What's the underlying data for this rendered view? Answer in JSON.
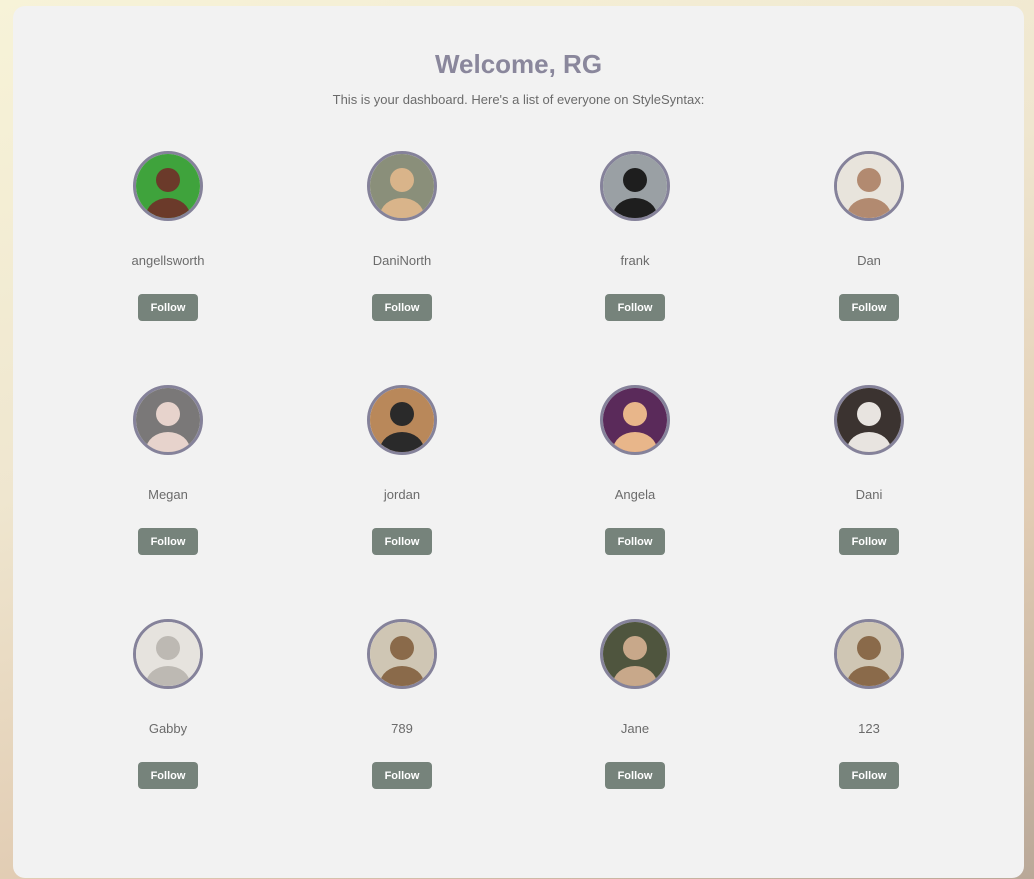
{
  "header": {
    "title": "Welcome, RG",
    "subtitle": "This is your dashboard. Here's a list of everyone on StyleSyntax:"
  },
  "users": [
    {
      "name": "angellsworth",
      "follow_label": "Follow",
      "avatar": "photo-avatar-icon",
      "bg": "#3fa33c",
      "fg": "#6b3a2a"
    },
    {
      "name": "DaniNorth",
      "follow_label": "Follow",
      "avatar": "photo-avatar-icon",
      "bg": "#8a8f7a",
      "fg": "#d9b48a"
    },
    {
      "name": "frank",
      "follow_label": "Follow",
      "avatar": "photo-avatar-icon",
      "bg": "#9aa0a4",
      "fg": "#1e1e1e"
    },
    {
      "name": "Dan",
      "follow_label": "Follow",
      "avatar": "photo-avatar-icon",
      "bg": "#e8e4dc",
      "fg": "#b28a70"
    },
    {
      "name": "Megan",
      "follow_label": "Follow",
      "avatar": "photo-avatar-icon",
      "bg": "#7a7878",
      "fg": "#e7d3cc"
    },
    {
      "name": "jordan",
      "follow_label": "Follow",
      "avatar": "photo-avatar-icon",
      "bg": "#b9885a",
      "fg": "#2a2a2a"
    },
    {
      "name": "Angela",
      "follow_label": "Follow",
      "avatar": "photo-avatar-icon",
      "bg": "#5a2a5a",
      "fg": "#e8b68a"
    },
    {
      "name": "Dani",
      "follow_label": "Follow",
      "avatar": "photo-avatar-icon",
      "bg": "#3b3330",
      "fg": "#e8e4e0"
    },
    {
      "name": "Gabby",
      "follow_label": "Follow",
      "avatar": "default-avatar-icon",
      "bg": "#e6e3de",
      "fg": "#bdb9b3"
    },
    {
      "name": "789",
      "follow_label": "Follow",
      "avatar": "photo-avatar-icon",
      "bg": "#cfc6b4",
      "fg": "#8a6a4a"
    },
    {
      "name": "Jane",
      "follow_label": "Follow",
      "avatar": "photo-avatar-icon",
      "bg": "#4f553e",
      "fg": "#c8a88a"
    },
    {
      "name": "123",
      "follow_label": "Follow",
      "avatar": "photo-avatar-icon",
      "bg": "#cfc6b4",
      "fg": "#8a6a4a"
    }
  ]
}
